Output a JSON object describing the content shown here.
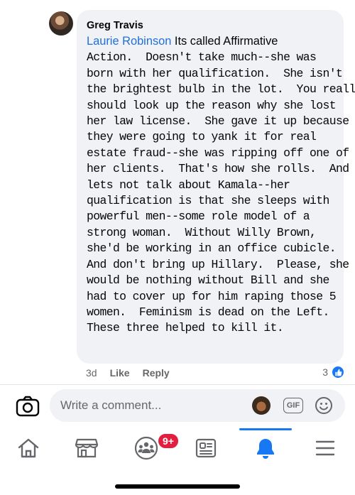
{
  "comment": {
    "author": "Greg Travis",
    "mention": "Laurie Robinson",
    "lines": [
      " Its called Affirmative",
      "Action.  Doesn't take much--she was",
      "born with her qualification.  She isn't",
      "the brightest bulb in the lot.  You really",
      "should look up the reason why she lost",
      "her law license.  She gave it up because",
      "they were going to yank it for real",
      "estate fraud--she was ripping off one of",
      "her clients.  That's how she rolls.  And",
      "lets not talk about Kamala--her",
      "qualification is that she sleeps with",
      "powerful men--some role model of a",
      "strong woman.  Without Willy Brown,",
      "she'd be working in an office cubicle.",
      "And don't bring up Hillary.  Please, she",
      "would be nothing without Bill and she",
      "had to cover up for him raping those 5",
      "women.  Feminism is dead on the Left.",
      "These three helped to kill it."
    ],
    "time": "3d",
    "like_label": "Like",
    "reply_label": "Reply",
    "reaction_count": "3",
    "reaction_icon": "like-icon"
  },
  "composer": {
    "placeholder": "Write a comment...",
    "gif_label": "GIF"
  },
  "nav": {
    "items": [
      "home-icon",
      "marketplace-icon",
      "groups-icon",
      "news-icon",
      "notifications-icon",
      "menu-icon"
    ],
    "groups_badge": "9+",
    "active": "notifications-icon"
  },
  "colors": {
    "accent": "#1877f2",
    "mention": "#216fdb",
    "bubble": "#f0f2f5",
    "badge": "#e41e3f",
    "muted": "#65676b"
  }
}
